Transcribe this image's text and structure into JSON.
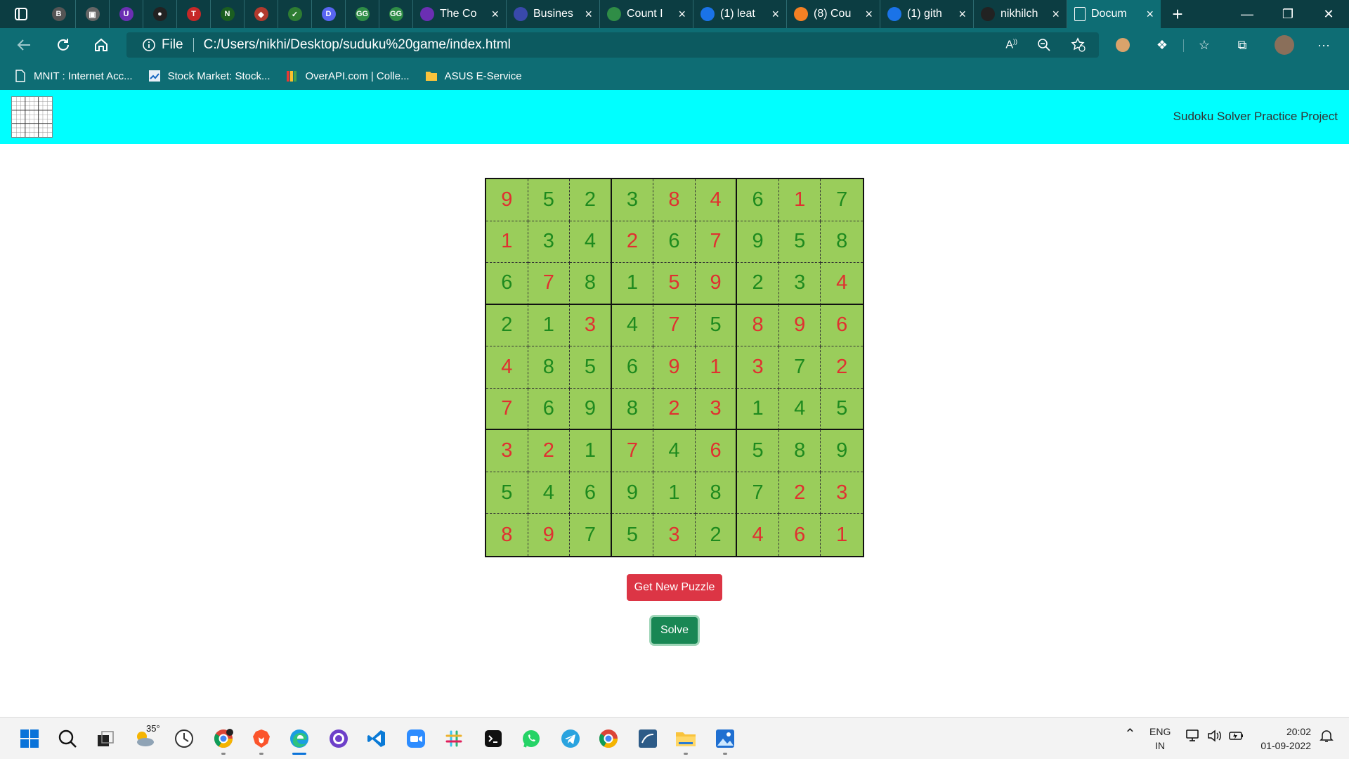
{
  "browser": {
    "pinned_tabs": [
      {
        "icon": "coin-icon",
        "color": "#555555"
      },
      {
        "icon": "image-icon",
        "color": "#666666"
      },
      {
        "icon": "udemy-icon",
        "color": "#6b2fb3"
      },
      {
        "icon": "github-icon",
        "color": "#222222"
      },
      {
        "icon": "tuf-icon",
        "color": "#c62828"
      },
      {
        "icon": "nse-icon",
        "color": "#1b5e20"
      },
      {
        "icon": "app-icon",
        "color": "#b23a2e"
      },
      {
        "icon": "shield-icon",
        "color": "#2e7d32"
      },
      {
        "icon": "discord-icon",
        "color": "#5865f2"
      },
      {
        "icon": "gfg-icon",
        "color": "#2f8d46"
      },
      {
        "icon": "gfg-icon",
        "color": "#2f8d46"
      }
    ],
    "tabs": [
      {
        "title": "The Co",
        "icon": "udemy-icon",
        "color": "#6b2fb3"
      },
      {
        "title": "Busines",
        "icon": "r-icon",
        "color": "#3949ab"
      },
      {
        "title": "Count I",
        "icon": "gfg-icon",
        "color": "#2f8d46"
      },
      {
        "title": "(1) leat",
        "icon": "search-icon",
        "color": "#1a73e8"
      },
      {
        "title": "(8) Cou",
        "icon": "stack-icon",
        "color": "#f48024"
      },
      {
        "title": "(1) gith",
        "icon": "search-icon",
        "color": "#1a73e8"
      },
      {
        "title": "nikhilch",
        "icon": "github-icon",
        "color": "#222222"
      },
      {
        "title": "Docum",
        "icon": "document-icon",
        "color": "#ffffff",
        "active": true
      }
    ],
    "address": {
      "label": "File",
      "url": "C:/Users/nikhi/Desktop/suduku%20game/index.html"
    },
    "bookmarks": [
      {
        "label": "MNIT : Internet Acc...",
        "icon": "page-icon"
      },
      {
        "label": "Stock Market: Stock...",
        "icon": "chart-icon"
      },
      {
        "label": "OverAPI.com | Colle...",
        "icon": "books-icon"
      },
      {
        "label": "ASUS E-Service",
        "icon": "folder-icon"
      }
    ]
  },
  "page": {
    "header_title": "Sudoku Solver Practice Project",
    "new_puzzle_label": "Get New Puzzle",
    "solve_label": "Solve",
    "colors": {
      "header_bg": "#00ffff",
      "cell_bg": "#9acd5b",
      "given": "#1e8a1e",
      "solved": "#e03030"
    },
    "grid": [
      [
        [
          9,
          "r"
        ],
        [
          5,
          "g"
        ],
        [
          2,
          "g"
        ],
        [
          3,
          "g"
        ],
        [
          8,
          "r"
        ],
        [
          4,
          "r"
        ],
        [
          6,
          "g"
        ],
        [
          1,
          "r"
        ],
        [
          7,
          "g"
        ]
      ],
      [
        [
          1,
          "r"
        ],
        [
          3,
          "g"
        ],
        [
          4,
          "g"
        ],
        [
          2,
          "r"
        ],
        [
          6,
          "g"
        ],
        [
          7,
          "r"
        ],
        [
          9,
          "g"
        ],
        [
          5,
          "g"
        ],
        [
          8,
          "g"
        ]
      ],
      [
        [
          6,
          "g"
        ],
        [
          7,
          "r"
        ],
        [
          8,
          "g"
        ],
        [
          1,
          "g"
        ],
        [
          5,
          "r"
        ],
        [
          9,
          "r"
        ],
        [
          2,
          "g"
        ],
        [
          3,
          "g"
        ],
        [
          4,
          "r"
        ]
      ],
      [
        [
          2,
          "g"
        ],
        [
          1,
          "g"
        ],
        [
          3,
          "r"
        ],
        [
          4,
          "g"
        ],
        [
          7,
          "r"
        ],
        [
          5,
          "g"
        ],
        [
          8,
          "r"
        ],
        [
          9,
          "r"
        ],
        [
          6,
          "r"
        ]
      ],
      [
        [
          4,
          "r"
        ],
        [
          8,
          "g"
        ],
        [
          5,
          "g"
        ],
        [
          6,
          "g"
        ],
        [
          9,
          "r"
        ],
        [
          1,
          "r"
        ],
        [
          3,
          "r"
        ],
        [
          7,
          "g"
        ],
        [
          2,
          "r"
        ]
      ],
      [
        [
          7,
          "r"
        ],
        [
          6,
          "g"
        ],
        [
          9,
          "g"
        ],
        [
          8,
          "g"
        ],
        [
          2,
          "r"
        ],
        [
          3,
          "r"
        ],
        [
          1,
          "g"
        ],
        [
          4,
          "g"
        ],
        [
          5,
          "g"
        ]
      ],
      [
        [
          3,
          "r"
        ],
        [
          2,
          "r"
        ],
        [
          1,
          "g"
        ],
        [
          7,
          "r"
        ],
        [
          4,
          "g"
        ],
        [
          6,
          "r"
        ],
        [
          5,
          "g"
        ],
        [
          8,
          "g"
        ],
        [
          9,
          "g"
        ]
      ],
      [
        [
          5,
          "g"
        ],
        [
          4,
          "g"
        ],
        [
          6,
          "g"
        ],
        [
          9,
          "g"
        ],
        [
          1,
          "g"
        ],
        [
          8,
          "g"
        ],
        [
          7,
          "g"
        ],
        [
          2,
          "r"
        ],
        [
          3,
          "r"
        ]
      ],
      [
        [
          8,
          "r"
        ],
        [
          9,
          "r"
        ],
        [
          7,
          "g"
        ],
        [
          5,
          "g"
        ],
        [
          3,
          "r"
        ],
        [
          2,
          "g"
        ],
        [
          4,
          "r"
        ],
        [
          6,
          "r"
        ],
        [
          1,
          "r"
        ]
      ]
    ]
  },
  "taskbar": {
    "weather_temp": "35°",
    "language": "ENG",
    "region": "IN",
    "time": "20:02",
    "date": "01-09-2022"
  }
}
